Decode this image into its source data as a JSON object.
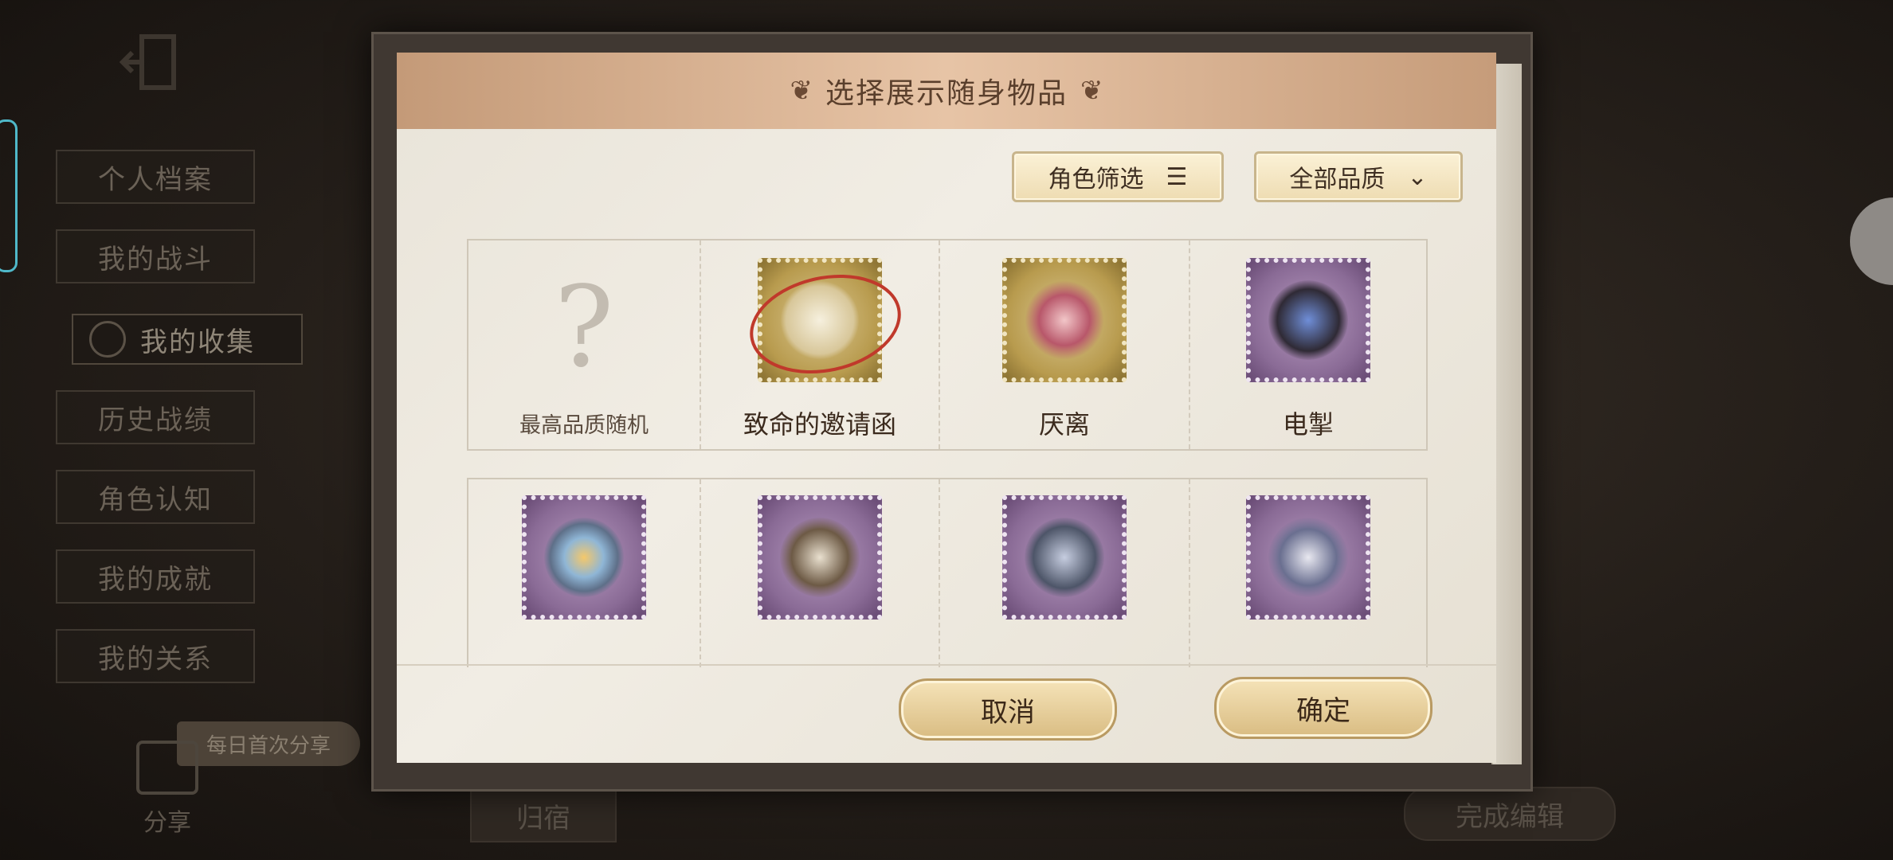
{
  "side_nav": {
    "items": [
      {
        "label": "个人档案"
      },
      {
        "label": "我的战斗"
      },
      {
        "label": "我的收集"
      },
      {
        "label": "历史战绩"
      },
      {
        "label": "角色认知"
      },
      {
        "label": "我的成就"
      },
      {
        "label": "我的关系"
      }
    ],
    "active_index": 2
  },
  "share": {
    "label": "分享",
    "daily_label": "每日首次分享"
  },
  "background_buttons": {
    "left": "归宿",
    "finish_edit": "完成编辑"
  },
  "dialog": {
    "title": "选择展示随身物品",
    "filters": {
      "role_filter": "角色筛选",
      "quality_filter": "全部品质"
    },
    "items": [
      {
        "name": "最高品质随机",
        "frame": "none",
        "icon": "question-mark-icon"
      },
      {
        "name": "致命的邀请函",
        "frame": "gold",
        "icon": "winged-letter-icon"
      },
      {
        "name": "厌离",
        "frame": "gold",
        "icon": "winged-staff-icon"
      },
      {
        "name": "电掣",
        "frame": "purple",
        "icon": "lightning-boot-icon"
      },
      {
        "name": "",
        "frame": "purple",
        "icon": "pearl-shell-icon"
      },
      {
        "name": "",
        "frame": "purple",
        "icon": "goat-figure-icon"
      },
      {
        "name": "",
        "frame": "purple",
        "icon": "crystal-shard-icon"
      },
      {
        "name": "",
        "frame": "purple",
        "icon": "hourglass-icon"
      }
    ],
    "cancel_label": "取消",
    "confirm_label": "确定"
  },
  "colors": {
    "gold_frame": "#b89b4e",
    "purple_frame": "#8a6b96",
    "header_band": "#e7c4a6",
    "highlight_circle": "#c0392b"
  }
}
